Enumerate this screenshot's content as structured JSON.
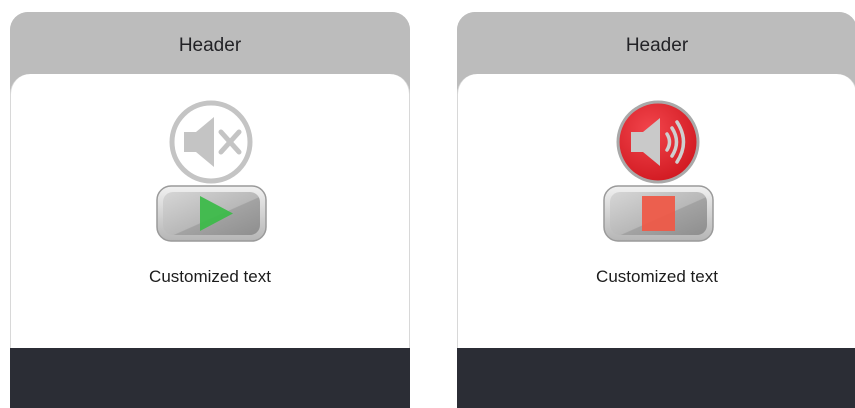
{
  "panels": [
    {
      "id": "left",
      "header": "Header",
      "speaker_state": "muted",
      "speaker_icon": "speaker-muted-icon",
      "button_icon": "play-icon",
      "caption": "Customized text"
    },
    {
      "id": "right",
      "header": "Header",
      "speaker_state": "sound-on",
      "speaker_icon": "speaker-sound-icon",
      "button_icon": "stop-icon",
      "caption": "Customized text"
    }
  ],
  "colors": {
    "header_bg": "#bcbcbc",
    "body_bg": "#ffffff",
    "footer_bg": "#2b2d35",
    "mute_icon": "#c4c4c4",
    "speaker_active_red": "#e8212b",
    "play_green": "#3dbb4a",
    "stop_red": "#ee5a48",
    "button_gray": "#a8a8a8"
  }
}
